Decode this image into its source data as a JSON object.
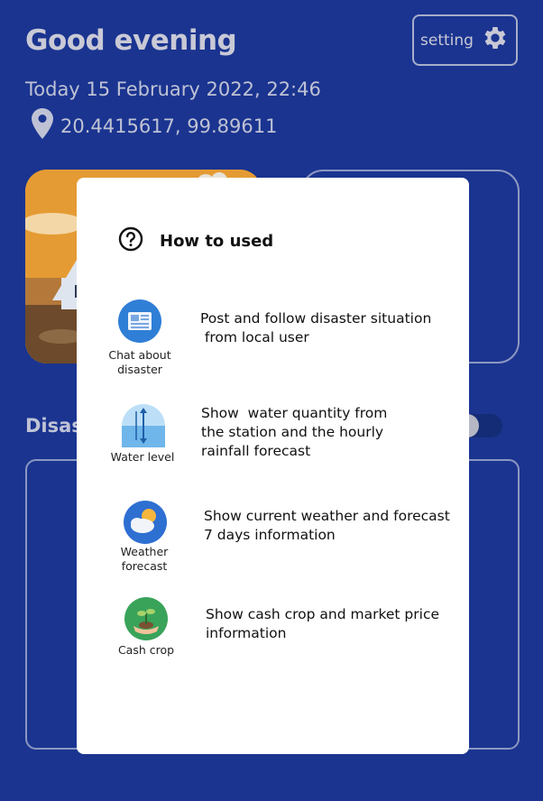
{
  "header": {
    "greeting": "Good evening",
    "settings_label": "setting",
    "datetime": "Today 15 February 2022, 22:46",
    "coordinates": "20.4415617, 99.89611"
  },
  "background": {
    "section_label": "Disast"
  },
  "modal": {
    "title": "How to used",
    "items": [
      {
        "icon": "news-icon",
        "label": "Chat about\ndisaster",
        "description": "Post and follow disaster situation\n from local user"
      },
      {
        "icon": "water-level-icon",
        "label": "Water level",
        "description": "Show  water quantity from\nthe station and the hourly\nrainfall forecast"
      },
      {
        "icon": "weather-icon",
        "label": "Weather\nforecast",
        "description": "Show current weather and forecast\n7 days information"
      },
      {
        "icon": "plant-icon",
        "label": "Cash crop",
        "description": "Show cash crop and market price\ninformation"
      }
    ]
  },
  "colors": {
    "background": "#1a3490",
    "modal": "#ffffff"
  }
}
